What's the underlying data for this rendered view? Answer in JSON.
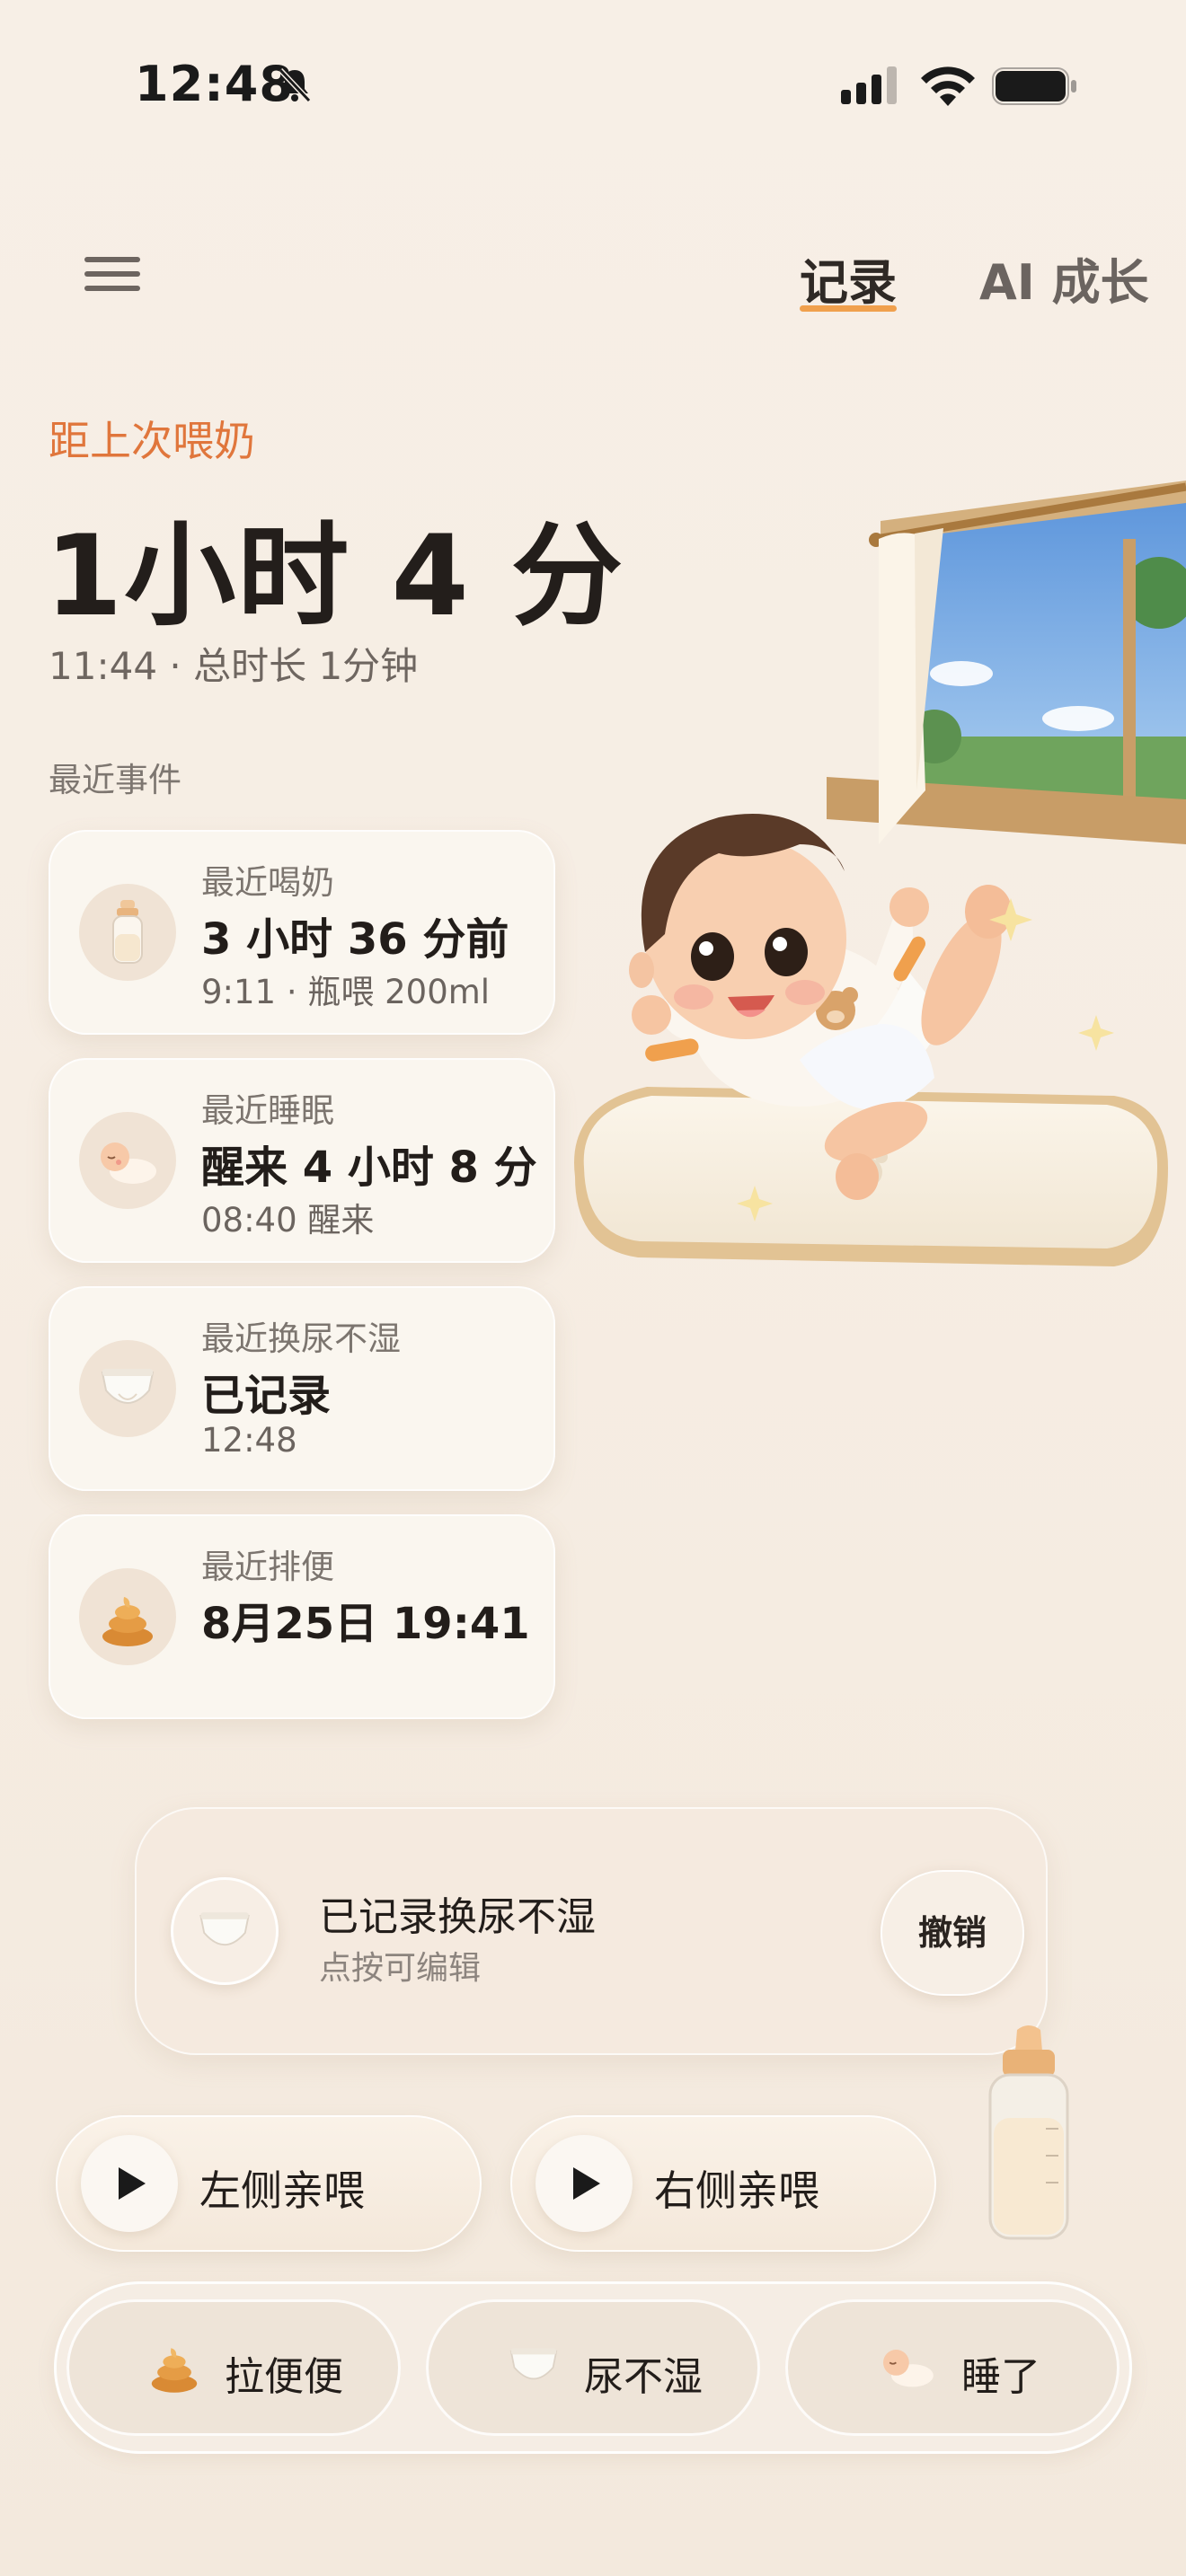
{
  "status_bar": {
    "time": "12:48"
  },
  "nav": {
    "tab_record": "记录",
    "tab_ai": "AI 成长"
  },
  "header": {
    "since_label": "距上次喂奶",
    "elapsed": "1小时 4 分",
    "detail": "11:44 · 总时长 1分钟",
    "recent_title": "最近事件"
  },
  "events": [
    {
      "label": "最近喝奶",
      "main": "3 小时 36 分前",
      "sub": "9:11 · 瓶喂 200ml",
      "icon": "bottle-icon"
    },
    {
      "label": "最近睡眠",
      "main": "醒来 4 小时 8 分",
      "sub": "08:40 醒来",
      "icon": "sleeping-baby-icon"
    },
    {
      "label": "最近换尿不湿",
      "main": "已记录",
      "sub": "12:48",
      "icon": "diaper-icon"
    },
    {
      "label": "最近排便",
      "main": "8月25日 19:41",
      "icon": "poop-icon"
    }
  ],
  "toast": {
    "title": "已记录换尿不湿",
    "subtitle": "点按可编辑",
    "undo_label": "撤销"
  },
  "nursing": {
    "left_label": "左侧亲喂",
    "right_label": "右侧亲喂"
  },
  "quick_actions": [
    {
      "label": "拉便便",
      "icon": "poop-icon"
    },
    {
      "label": "尿不湿",
      "icon": "diaper-icon"
    },
    {
      "label": "睡了",
      "icon": "sleeping-baby-icon"
    }
  ],
  "colors": {
    "accent": "#e0763c",
    "tab_underline": "#f0a04d",
    "background": "#f7efe6"
  }
}
